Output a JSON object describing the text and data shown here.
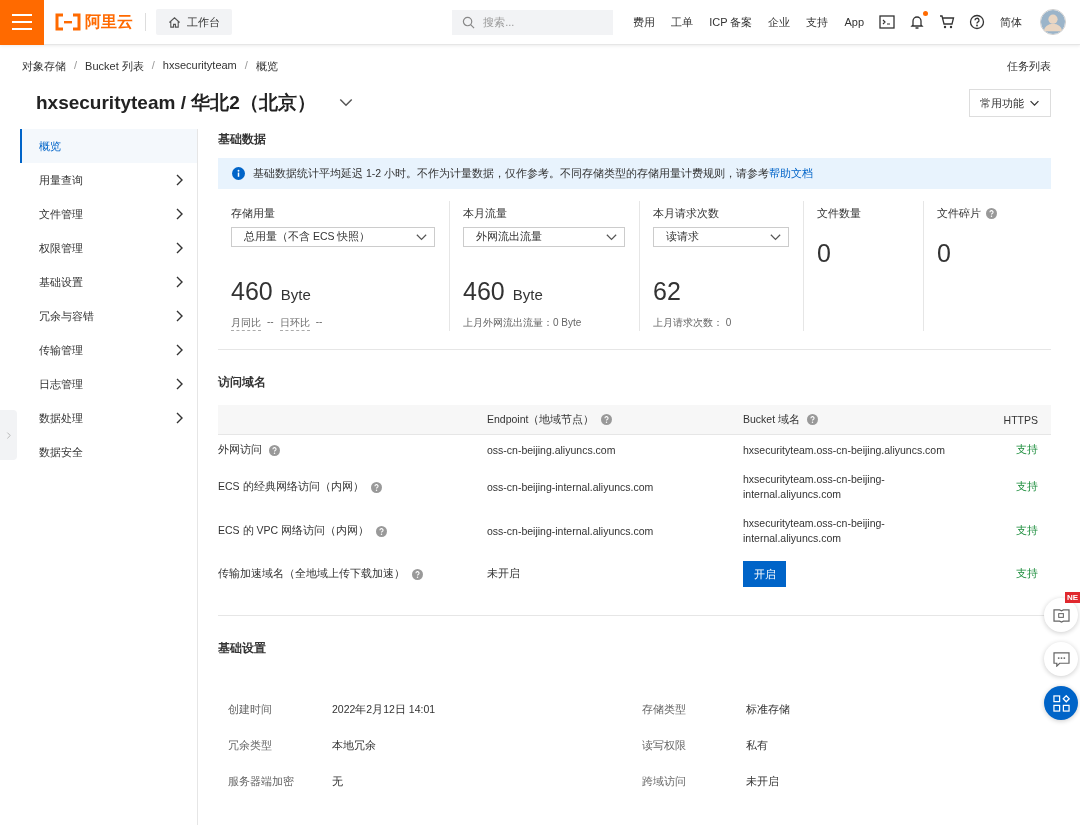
{
  "topbar": {
    "logo_text": "阿里云",
    "workbench": "工作台",
    "search": {
      "placeholder": "搜索..."
    },
    "links": [
      "费用",
      "工单",
      "ICP 备案",
      "企业",
      "支持",
      "App"
    ],
    "notification_dot": true,
    "language": "简体"
  },
  "breadcrumb": {
    "items": [
      "对象存储",
      "Bucket 列表",
      "hxsecurityteam",
      "概览"
    ],
    "separators": [
      "/",
      "/",
      "/"
    ]
  },
  "task_list": "任务列表",
  "title": "hxsecurityteam / 华北2（北京）",
  "common_functions": "常用功能",
  "sidebar": {
    "items": [
      {
        "label": "概览",
        "selected": true,
        "kind": "link"
      },
      {
        "label": "用量查询",
        "selected": false,
        "kind": "group"
      },
      {
        "label": "文件管理",
        "selected": false,
        "kind": "group"
      },
      {
        "label": "权限管理",
        "selected": false,
        "kind": "group"
      },
      {
        "label": "基础设置",
        "selected": false,
        "kind": "group"
      },
      {
        "label": "冗余与容错",
        "selected": false,
        "kind": "group"
      },
      {
        "label": "传输管理",
        "selected": false,
        "kind": "group"
      },
      {
        "label": "日志管理",
        "selected": false,
        "kind": "group"
      },
      {
        "label": "数据处理",
        "selected": false,
        "kind": "group"
      },
      {
        "label": "数据安全",
        "selected": false,
        "kind": "link"
      }
    ]
  },
  "basic_data": {
    "title": "基础数据",
    "notice": "基础数据统计平均延迟 1-2 小时。不作为计量数据，仅作参考。不同存储类型的存储用量计费规则，请参考",
    "notice_link": "帮助文档",
    "metrics": [
      {
        "label": "存储用量",
        "select": "总用量（不含 ECS 快照）",
        "value": "460",
        "unit": "Byte",
        "footer": [
          "月同比",
          "--",
          "日环比",
          "--"
        ]
      },
      {
        "label": "本月流量",
        "select": "外网流出流量",
        "value": "460",
        "unit": "Byte",
        "footer": [
          "上月外网流出流量：0 Byte"
        ]
      },
      {
        "label": "本月请求次数",
        "select": "读请求",
        "value": "62",
        "footer": [
          "上月请求次数： 0"
        ]
      },
      {
        "label": "文件数量",
        "value": "0"
      },
      {
        "label": "文件碎片",
        "help": true,
        "value": "0"
      }
    ]
  },
  "domains": {
    "title": "访问域名",
    "columns": [
      {
        "label": "Endpoint（地域节点）",
        "help": true
      },
      {
        "label": "Bucket 域名",
        "help": true
      },
      {
        "label": "HTTPS"
      }
    ],
    "rows": [
      {
        "name": "外网访问",
        "endpoint": "oss-cn-beijing.aliyuncs.com",
        "bucket_domain": [
          "hxsecurityteam.oss-cn-beijing.aliyuncs.com"
        ],
        "https": "支持"
      },
      {
        "name": "ECS 的经典网络访问（内网）",
        "endpoint": "oss-cn-beijing-internal.aliyuncs.com",
        "bucket_domain": [
          "hxsecurityteam.oss-cn-beijing-",
          "internal.aliyuncs.com"
        ],
        "https": "支持"
      },
      {
        "name": "ECS 的 VPC 网络访问（内网）",
        "endpoint": "oss-cn-beijing-internal.aliyuncs.com",
        "bucket_domain": [
          "hxsecurityteam.oss-cn-beijing-",
          "internal.aliyuncs.com"
        ],
        "https": "支持"
      },
      {
        "name": "传输加速域名（全地域上传下载加速）",
        "endpoint": "未开启",
        "button": "开启",
        "https": "支持"
      }
    ]
  },
  "basic_settings": {
    "title": "基础设置",
    "fields": [
      {
        "label": "创建时间",
        "value": "2022年2月12日 14:01"
      },
      {
        "label": "存储类型",
        "value": "标准存储"
      },
      {
        "label": "冗余类型",
        "value": "本地冗余"
      },
      {
        "label": "读写权限",
        "value": "私有"
      },
      {
        "label": "服务器端加密",
        "value": "无"
      },
      {
        "label": "跨域访问",
        "value": "未开启"
      }
    ]
  },
  "floating": {
    "badge": "NE"
  }
}
